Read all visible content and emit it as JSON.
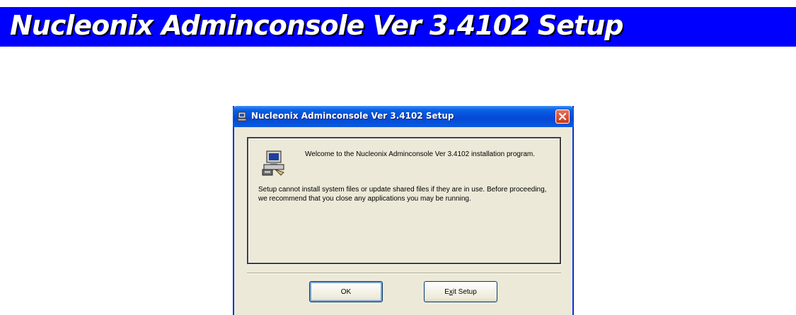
{
  "banner": {
    "title": "Nucleonix Adminconsole Ver 3.4102 Setup"
  },
  "dialog": {
    "title": "Nucleonix Adminconsole Ver 3.4102 Setup",
    "welcome_text": "Welcome to the Nucleonix Adminconsole Ver 3.4102 installation program.",
    "warning_text": "Setup cannot install system files or update shared files if they are in use. Before proceeding, we recommend that you close any applications you may be running.",
    "ok_label": "OK",
    "exit_label_pre": "E",
    "exit_label_accel": "x",
    "exit_label_post": "it Setup"
  },
  "colors": {
    "banner_bg": "#0000ff",
    "titlebar": "#0548d6",
    "dialog_bg": "#ece9d8"
  },
  "icons": [
    "setup-computer-icon",
    "close-icon"
  ]
}
